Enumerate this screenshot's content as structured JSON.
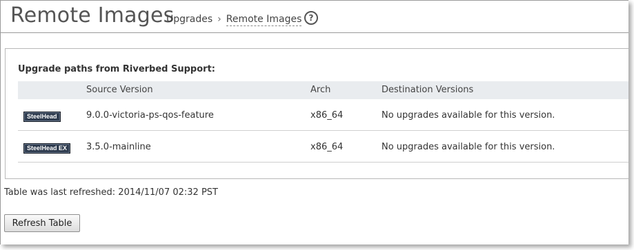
{
  "header": {
    "title": "Remote Images",
    "breadcrumb": {
      "parent": "Upgrades",
      "separator": "›",
      "current": "Remote Images"
    },
    "help_icon": "?"
  },
  "panel": {
    "section_title": "Upgrade paths from Riverbed Support:",
    "table": {
      "columns": [
        "",
        "Source Version",
        "Arch",
        "Destination Versions"
      ],
      "rows": [
        {
          "product_badge": "SteelHead",
          "source_version": "9.0.0-victoria-ps-qos-feature",
          "arch": "x86_64",
          "destination_versions": "No upgrades available for this version."
        },
        {
          "product_badge": "SteelHead EX",
          "source_version": "3.5.0-mainline",
          "arch": "x86_64",
          "destination_versions": "No upgrades available for this version."
        }
      ]
    }
  },
  "refresh_status": "Table was last refreshed: 2014/11/07 02:32 PST",
  "refresh_button_label": "Refresh Table",
  "colors": {
    "header_bg": "#e9ecef",
    "badge_bg": "#2e3b4e",
    "title_text": "#555555"
  }
}
